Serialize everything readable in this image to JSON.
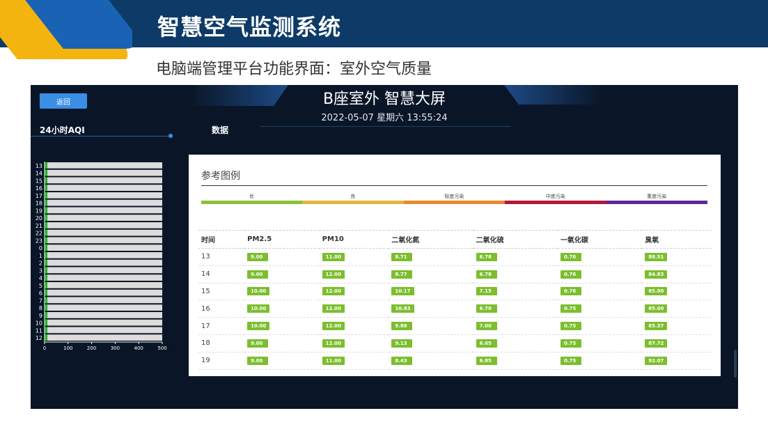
{
  "slide": {
    "title": "智慧空气监测系统",
    "subtitle": "电脑端管理平台功能界面：室外空气质量"
  },
  "screen": {
    "back_label": "返回",
    "title": "B座室外 智慧大屏",
    "datetime": "2022-05-07 星期六 13:55:24",
    "aqi_section": "24小时AQI",
    "data_section": "数据"
  },
  "chart_data": {
    "type": "bar",
    "orientation": "horizontal",
    "categories": [
      "13",
      "14",
      "15",
      "16",
      "17",
      "18",
      "19",
      "20",
      "21",
      "22",
      "23",
      "0",
      "1",
      "2",
      "3",
      "4",
      "5",
      "6",
      "7",
      "8",
      "9",
      "10",
      "11",
      "12"
    ],
    "values": [
      12,
      12,
      12,
      12,
      12,
      12,
      12,
      12,
      12,
      12,
      12,
      12,
      12,
      12,
      12,
      12,
      12,
      12,
      12,
      12,
      12,
      12,
      12,
      12
    ],
    "xlim": [
      0,
      500
    ],
    "xticks": [
      0,
      100,
      200,
      300,
      400,
      500
    ],
    "bar_color": "#22b822",
    "track_color": "#dcdcdc"
  },
  "legend": {
    "title": "参考图例",
    "items": [
      {
        "label": "优",
        "color": "#8cbf3a"
      },
      {
        "label": "良",
        "color": "#e2b73a"
      },
      {
        "label": "轻度污染",
        "color": "#e58a2e"
      },
      {
        "label": "中度污染",
        "color": "#b3173a"
      },
      {
        "label": "重度污染",
        "color": "#5d2a8c"
      }
    ]
  },
  "table": {
    "headers": [
      "时间",
      "PM2.5",
      "PM10",
      "二氧化氮",
      "二氧化硫",
      "一氧化碳",
      "臭氧"
    ],
    "rows": [
      [
        "13",
        "9.00",
        "11.00",
        "8.71",
        "6.78",
        "0.76",
        "88.51"
      ],
      [
        "14",
        "9.00",
        "12.00",
        "8.77",
        "6.78",
        "0.76",
        "84.83"
      ],
      [
        "15",
        "10.00",
        "12.00",
        "10.17",
        "7.15",
        "0.76",
        "85.00"
      ],
      [
        "16",
        "10.00",
        "12.00",
        "10.83",
        "6.70",
        "0.75",
        "85.00"
      ],
      [
        "17",
        "10.00",
        "12.00",
        "9.88",
        "7.00",
        "0.75",
        "85.37"
      ],
      [
        "18",
        "9.00",
        "12.00",
        "9.13",
        "6.65",
        "0.75",
        "87.72"
      ],
      [
        "19",
        "9.00",
        "11.00",
        "8.43",
        "6.85",
        "0.75",
        "92.07"
      ]
    ]
  }
}
